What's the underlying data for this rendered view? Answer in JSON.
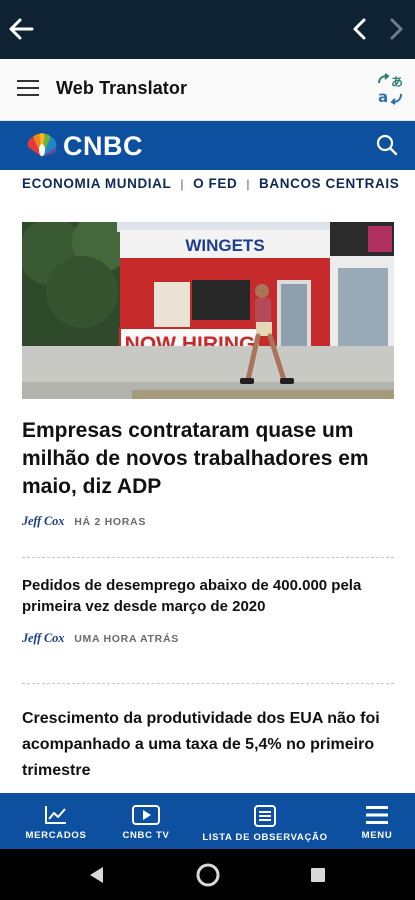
{
  "browser": {
    "back_icon": "arrow-left-icon",
    "prev_icon": "chevron-left-icon",
    "next_icon": "chevron-right-icon",
    "background": "#0e2233"
  },
  "translator": {
    "title": "Web Translator",
    "menu_icon": "hamburger-menu-icon",
    "translate_icon": "translate-icon"
  },
  "site": {
    "brand": "CNBC",
    "brand_color": "#0d50a0",
    "search_icon": "search-icon"
  },
  "nav": {
    "items": [
      "ECONOMIA MUNDIAL",
      "O FED",
      "BANCOS CENTRAIS"
    ],
    "separator": "|"
  },
  "articles": [
    {
      "title": "Empresas contrataram quase um milhão de novos trabalhadores em maio, diz ADP",
      "author": "Jeff Cox",
      "time": "HÁ 2 HORAS"
    },
    {
      "title": "Pedidos de desemprego abaixo de 400.000 pela primeira vez desde março de 2020",
      "author": "Jeff Cox",
      "time": "UMA HORA ATRÁS"
    },
    {
      "title": "Crescimento da produtividade dos EUA não foi acompanhado a uma taxa de 5,4% no primeiro trimestre"
    }
  ],
  "hero_image": {
    "sign_text": "WINGETS",
    "banner_text": "NOW HIRING"
  },
  "tabbar": {
    "items": [
      {
        "label": "MERCADOS",
        "icon": "chart-icon"
      },
      {
        "label": "CNBC TV",
        "icon": "play-icon"
      },
      {
        "label": "LISTA DE OBSERVAÇÃO",
        "icon": "watchlist-icon"
      },
      {
        "label": "MENU",
        "icon": "menu-icon"
      }
    ]
  },
  "system_nav": {
    "back": "android-back-icon",
    "home": "android-home-icon",
    "recents": "android-recents-icon"
  }
}
